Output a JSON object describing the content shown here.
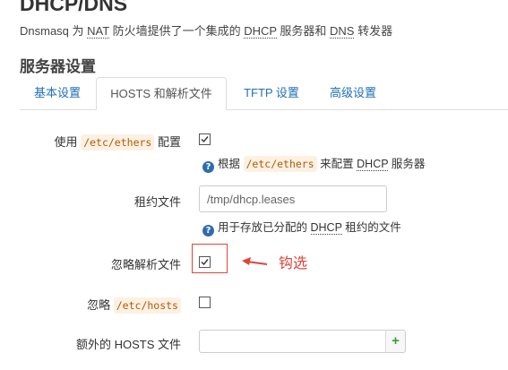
{
  "header": {
    "title": "DHCP/DNS",
    "desc_prefix": "Dnsmasq 为 ",
    "desc_nat": "NAT",
    "desc_mid1": " 防火墙提供了一个集成的 ",
    "desc_dhcp": "DHCP",
    "desc_mid2": " 服务器和 ",
    "desc_dns": "DNS",
    "desc_suffix": " 转发器"
  },
  "section": {
    "title": "服务器设置"
  },
  "tabs": [
    {
      "label": "基本设置",
      "active": false
    },
    {
      "label": "HOSTS 和解析文件",
      "active": true
    },
    {
      "label": "TFTP 设置",
      "active": false
    },
    {
      "label": "高级设置",
      "active": false
    }
  ],
  "fields": {
    "ethers": {
      "label_prefix": "使用",
      "label_code": "/etc/ethers",
      "label_suffix": "配置",
      "checked": true,
      "help_prefix": "根据",
      "help_code": "/etc/ethers",
      "help_mid": "来配置",
      "help_dhcp": "DHCP",
      "help_suffix": "服务器"
    },
    "leasefile": {
      "label": "租约文件",
      "value": "/tmp/dhcp.leases",
      "help_prefix": "用于存放已分配的",
      "help_dhcp": "DHCP",
      "help_suffix": "租约的文件"
    },
    "noresolv": {
      "label": "忽略解析文件",
      "checked": true
    },
    "nohosts": {
      "label_prefix": "忽略",
      "label_code": "/etc/hosts",
      "checked": false
    },
    "addnhosts": {
      "label": "额外的 HOSTS 文件",
      "value": "",
      "add_label": "+"
    }
  },
  "annotation": {
    "text": "钩选",
    "color": "#e0443a"
  },
  "colors": {
    "link": "#1f6fb5",
    "help_icon": "#2f6cae",
    "add_icon": "#3a9a3a"
  }
}
